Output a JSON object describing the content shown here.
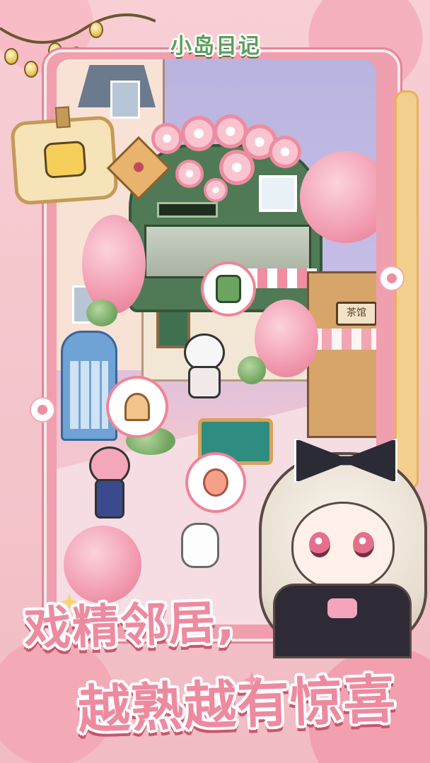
{
  "game": {
    "logo_text": "小岛日记",
    "slogan": {
      "line1": "戏精邻居,",
      "line2": "越熟越有惊喜"
    }
  },
  "scene": {
    "tea_house_sign": "茶馆",
    "bubbles": [
      {
        "item": "drink-icon"
      },
      {
        "item": "ice-cream-icon"
      },
      {
        "item": "bouquet-icon"
      }
    ],
    "mail_sign_icon": "smiley-mail-icon"
  },
  "colors": {
    "brand_pink": "#ee8aa0",
    "logo_green": "#5aa05a",
    "frame_pink": "#ef9fad",
    "shadow_pink": "#c8566e"
  }
}
